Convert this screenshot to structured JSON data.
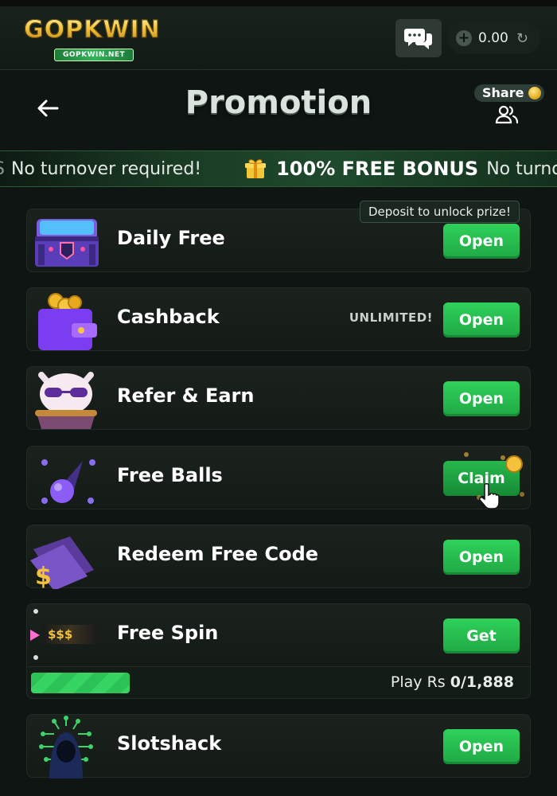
{
  "app": {
    "brand": "GOPKWIN",
    "brand_sub": "GOPKWIN.NET",
    "balance": "0.00"
  },
  "header": {
    "title": "Promotion",
    "share_label": "Share"
  },
  "ticker": {
    "lead": "S",
    "text1": "No turnover required!",
    "bonus": "100% FREE BONUS",
    "text2": "No turno"
  },
  "deposit_tip": "Deposit to unlock prize!",
  "promos": [
    {
      "label": "Daily Free",
      "button": "Open",
      "icon": "treasure-chest-icon"
    },
    {
      "label": "Cashback",
      "button": "Open",
      "tag": "UNLIMITED!",
      "icon": "wallet-coins-icon"
    },
    {
      "label": "Refer & Earn",
      "button": "Open",
      "icon": "cat-mascot-icon"
    },
    {
      "label": "Free Balls",
      "button": "Claim",
      "icon": "purple-ball-icon"
    },
    {
      "label": "Redeem Free Code",
      "button": "Open",
      "icon": "ticket-icon"
    },
    {
      "label": "Free Spin",
      "button": "Get",
      "icon": "slot-reel-icon",
      "thumb_text": "$$$"
    },
    {
      "label": "Slotshack",
      "button": "Open",
      "icon": "hacker-icon"
    }
  ],
  "free_spin_progress": {
    "prefix": "Play Rs ",
    "value": "0/1,888",
    "fraction": 0.2
  },
  "colors": {
    "background": "#0f1512",
    "accent_green": "#2fd15a",
    "gold": "#f0c237"
  }
}
